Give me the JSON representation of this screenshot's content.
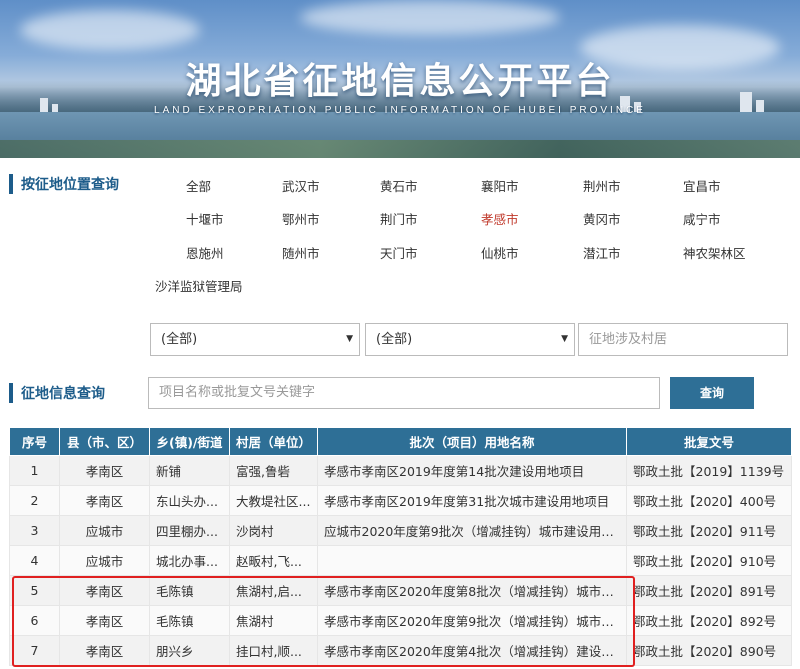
{
  "banner": {
    "title": "湖北省征地信息公开平台",
    "subtitle": "LAND EXPROPRIATION PUBLIC INFORMATION OF HUBEI PROVINCE"
  },
  "location_section": {
    "title": "按征地位置查询"
  },
  "regions": [
    "全部",
    "武汉市",
    "黄石市",
    "襄阳市",
    "荆州市",
    "宜昌市",
    "十堰市",
    "鄂州市",
    "荆门市",
    "孝感市",
    "黄冈市",
    "咸宁市",
    "恩施州",
    "随州市",
    "天门市",
    "仙桃市",
    "潜江市",
    "神农架林区",
    "沙洋监狱管理局"
  ],
  "active_region": "孝感市",
  "filters": {
    "county_select": "(全部)",
    "town_select": "(全部)",
    "village_placeholder": "征地涉及村居"
  },
  "info_section": {
    "title": "征地信息查询"
  },
  "search": {
    "placeholder": "项目名称或批复文号关键字",
    "button_label": "查询"
  },
  "table": {
    "columns": [
      "序号",
      "县（市、区）",
      "乡(镇)/街道",
      "村居（单位）",
      "批次（项目）用地名称",
      "批复文号"
    ],
    "rows": [
      [
        "1",
        "孝南区",
        "新铺",
        "富强,鲁砦",
        "孝感市孝南区2019年度第14批次建设用地项目",
        "鄂政土批【2019】1139号"
      ],
      [
        "2",
        "孝南区",
        "东山头办...",
        "大教堤社区...",
        "孝感市孝南区2019年度第31批次城市建设用地项目",
        "鄂政土批【2020】400号"
      ],
      [
        "3",
        "应城市",
        "四里棚办...",
        "沙岗村",
        "应城市2020年度第9批次（增减挂钩）城市建设用地...",
        "鄂政土批【2020】911号"
      ],
      [
        "4",
        "应城市",
        "城北办事...",
        "赵畈村,飞...",
        "",
        "鄂政土批【2020】910号"
      ],
      [
        "5",
        "孝南区",
        "毛陈镇",
        "焦湖村,启...",
        "孝感市孝南区2020年度第8批次（增减挂钩）城市建...",
        "鄂政土批【2020】891号"
      ],
      [
        "6",
        "孝南区",
        "毛陈镇",
        "焦湖村",
        "孝感市孝南区2020年度第9批次（增减挂钩）城市建...",
        "鄂政土批【2020】892号"
      ],
      [
        "7",
        "孝南区",
        "朋兴乡",
        "挂口村,顺...",
        "孝感市孝南区2020年度第4批次（增减挂钩）建设用...",
        "鄂政土批【2020】890号"
      ]
    ]
  }
}
